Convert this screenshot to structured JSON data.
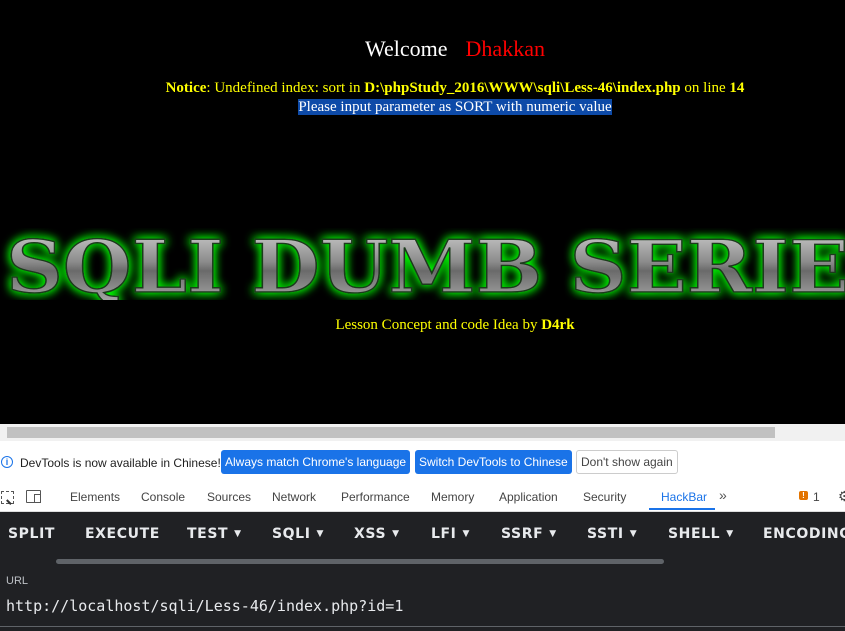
{
  "page": {
    "welcome": "Welcome",
    "username": "Dhakkan",
    "notice_label": "Notice",
    "notice_text": ": Undefined index: sort in ",
    "notice_path": "D:\\phpStudy_2016\\WWW\\sqli\\Less-46\\index.php",
    "notice_online": " on line ",
    "notice_line": "14",
    "hint": "Please input parameter as SORT with numeric value",
    "banner": "SQLI DUMB SERIES",
    "lesson_text": "Lesson Concept and code Idea by ",
    "lesson_author": "D4rk"
  },
  "infobar": {
    "message": "DevTools is now available in Chinese!",
    "btn_match": "Always match Chrome's language",
    "btn_switch": "Switch DevTools to Chinese",
    "btn_dont": "Don't show again"
  },
  "devtools": {
    "tabs": [
      "Elements",
      "Console",
      "Sources",
      "Network",
      "Performance",
      "Memory",
      "Application",
      "Security",
      "HackBar"
    ],
    "active_tab": "HackBar",
    "more": "»",
    "warning_count": "1"
  },
  "hackbar": {
    "menu": [
      "SPLIT",
      "EXECUTE",
      "TEST",
      "SQLI",
      "XSS",
      "LFI",
      "SSRF",
      "SSTI",
      "SHELL",
      "ENCODING"
    ],
    "url_label": "URL",
    "url_value": "http://localhost/sqli/Less-46/index.php?id=1"
  },
  "colors": {
    "welcome_user": "#ff0000",
    "notice": "#ffff00",
    "hint_bg": "#0d4aa8",
    "accent": "#1a73e8",
    "banner_glow": "#00ff00",
    "hackbar_bg": "#202124"
  }
}
